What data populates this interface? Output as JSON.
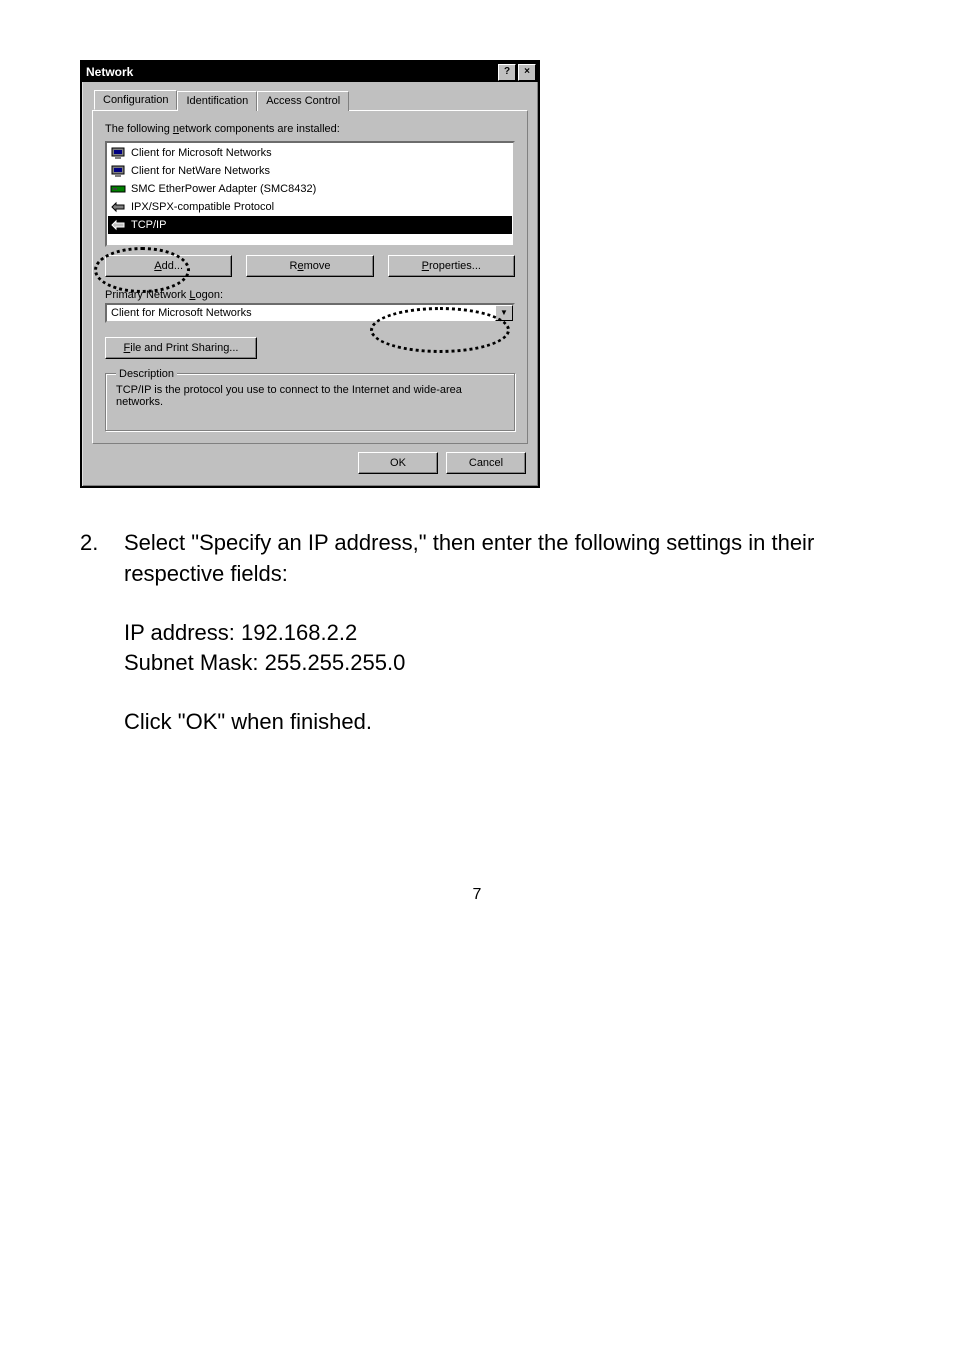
{
  "window": {
    "title": "Network",
    "help_icon": "?",
    "close_icon": "×"
  },
  "tabs": {
    "configuration": "Configuration",
    "identification": "Identification",
    "access_control": "Access Control"
  },
  "panel": {
    "installed_label": "The following network components are installed:",
    "items": [
      {
        "label": "Client for Microsoft Networks",
        "icon": "client"
      },
      {
        "label": "Client for NetWare Networks",
        "icon": "client"
      },
      {
        "label": "SMC EtherPower Adapter (SMC8432)",
        "icon": "adapter"
      },
      {
        "label": "IPX/SPX-compatible Protocol",
        "icon": "protocol"
      },
      {
        "label": "TCP/IP",
        "icon": "protocol",
        "selected": true
      }
    ],
    "add_label": "Add...",
    "remove_label": "Remove",
    "properties_label": "Properties...",
    "primary_logon_label": "Primary Network Logon:",
    "primary_logon_value": "Client for Microsoft Networks",
    "file_share_label": "File and Print Sharing...",
    "description_legend": "Description",
    "description_text": "TCP/IP is the protocol you use to connect to the Internet and wide-area networks.",
    "ok_label": "OK",
    "cancel_label": "Cancel"
  },
  "instructions": {
    "number": "2.",
    "step_text": "Select \"Specify an IP address,\" then enter the following settings in their respective fields:",
    "ip_line": "IP address: 192.168.2.2",
    "subnet_line": "Subnet Mask: 255.255.255.0",
    "click_ok": "Click \"OK\" when finished."
  },
  "page_number": "7"
}
